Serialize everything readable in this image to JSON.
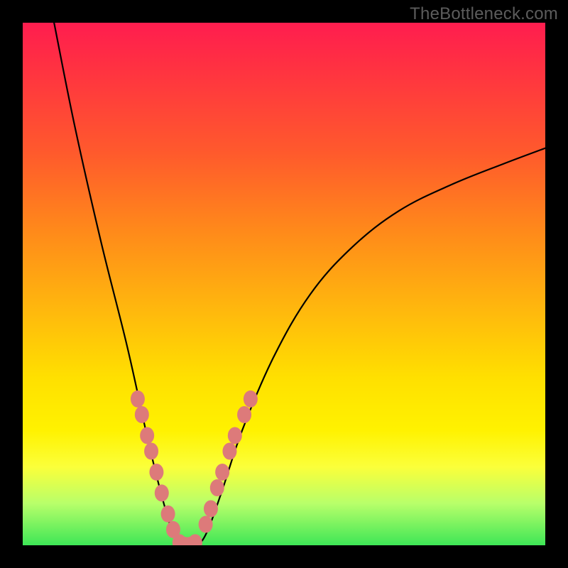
{
  "watermark": "TheBottleneck.com",
  "chart_data": {
    "type": "line",
    "title": "",
    "xlabel": "",
    "ylabel": "",
    "ylim": [
      0,
      100
    ],
    "xlim": [
      0,
      100
    ],
    "curve_note": "V-shaped bottleneck curve plunging to 0 near x≈31 then rising asymptotically toward 100.",
    "curve_points": [
      {
        "x": 6,
        "y": 100
      },
      {
        "x": 10,
        "y": 80
      },
      {
        "x": 15,
        "y": 58
      },
      {
        "x": 20,
        "y": 38
      },
      {
        "x": 24,
        "y": 20
      },
      {
        "x": 27,
        "y": 8
      },
      {
        "x": 29,
        "y": 2
      },
      {
        "x": 31,
        "y": 0
      },
      {
        "x": 33,
        "y": 0
      },
      {
        "x": 35,
        "y": 2
      },
      {
        "x": 38,
        "y": 10
      },
      {
        "x": 42,
        "y": 22
      },
      {
        "x": 48,
        "y": 36
      },
      {
        "x": 55,
        "y": 48
      },
      {
        "x": 63,
        "y": 57
      },
      {
        "x": 72,
        "y": 64
      },
      {
        "x": 82,
        "y": 69
      },
      {
        "x": 92,
        "y": 73
      },
      {
        "x": 100,
        "y": 76
      }
    ],
    "series": [
      {
        "name": "left-arm-dots",
        "values": [
          {
            "x": 22.0,
            "y": 28
          },
          {
            "x": 22.8,
            "y": 25
          },
          {
            "x": 23.8,
            "y": 21
          },
          {
            "x": 24.6,
            "y": 18
          },
          {
            "x": 25.6,
            "y": 14
          },
          {
            "x": 26.6,
            "y": 10
          },
          {
            "x": 27.8,
            "y": 6
          },
          {
            "x": 28.8,
            "y": 3
          }
        ]
      },
      {
        "name": "trough-dots",
        "values": [
          {
            "x": 30.0,
            "y": 0.5
          },
          {
            "x": 31.0,
            "y": 0
          },
          {
            "x": 32.0,
            "y": 0
          },
          {
            "x": 33.0,
            "y": 0.5
          }
        ]
      },
      {
        "name": "right-arm-dots",
        "values": [
          {
            "x": 35.0,
            "y": 4
          },
          {
            "x": 36.0,
            "y": 7
          },
          {
            "x": 37.2,
            "y": 11
          },
          {
            "x": 38.2,
            "y": 14
          },
          {
            "x": 39.6,
            "y": 18
          },
          {
            "x": 40.6,
            "y": 21
          },
          {
            "x": 42.4,
            "y": 25
          },
          {
            "x": 43.6,
            "y": 28
          }
        ]
      }
    ]
  }
}
